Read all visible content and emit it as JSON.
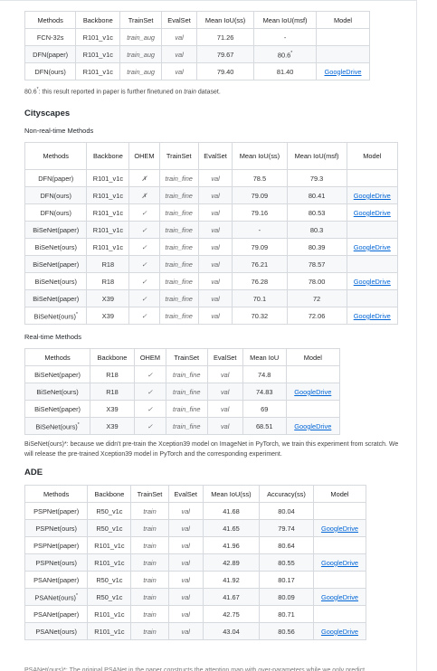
{
  "top_table": {
    "headers": [
      "Methods",
      "Backbone",
      "TrainSet",
      "EvalSet",
      "Mean IoU(ss)",
      "Mean IoU(msf)",
      "Model"
    ],
    "rows": [
      [
        "FCN-32s",
        "R101_v1c",
        "train_aug",
        "val",
        "71.26",
        "-",
        ""
      ],
      [
        "DFN(paper)",
        "R101_v1c",
        "train_aug",
        "val",
        "79.67",
        "80.6",
        ""
      ],
      [
        "DFN(ours)",
        "R101_v1c",
        "train_aug",
        "val",
        "79.40",
        "81.40",
        "GoogleDrive"
      ]
    ]
  },
  "top_note": {
    "prefix": "80.6",
    "middle": ": this result reported in paper is further finetuned on ",
    "italic": "train",
    "suffix": " dataset."
  },
  "cityscapes": {
    "title": "Cityscapes",
    "nonrealtime_title": "Non-real-time Methods",
    "nonrealtime_headers": [
      "Methods",
      "Backbone",
      "OHEM",
      "TrainSet",
      "EvalSet",
      "Mean IoU(ss)",
      "Mean IoU(msf)",
      "Model"
    ],
    "nonrealtime_rows": [
      [
        "DFN(paper)",
        "R101_v1c",
        "✗",
        "train_fine",
        "val",
        "78.5",
        "79.3",
        ""
      ],
      [
        "DFN(ours)",
        "R101_v1c",
        "✗",
        "train_fine",
        "val",
        "79.09",
        "80.41",
        "GoogleDrive"
      ],
      [
        "DFN(ours)",
        "R101_v1c",
        "✓",
        "train_fine",
        "val",
        "79.16",
        "80.53",
        "GoogleDrive"
      ],
      [
        "BiSeNet(paper)",
        "R101_v1c",
        "✓",
        "train_fine",
        "val",
        "-",
        "80.3",
        ""
      ],
      [
        "BiSeNet(ours)",
        "R101_v1c",
        "✓",
        "train_fine",
        "val",
        "79.09",
        "80.39",
        "GoogleDrive"
      ],
      [
        "BiSeNet(paper)",
        "R18",
        "✓",
        "train_fine",
        "val",
        "76.21",
        "78.57",
        ""
      ],
      [
        "BiSeNet(ours)",
        "R18",
        "✓",
        "train_fine",
        "val",
        "76.28",
        "78.00",
        "GoogleDrive"
      ],
      [
        "BiSeNet(paper)",
        "X39",
        "✓",
        "train_fine",
        "val",
        "70.1",
        "72",
        ""
      ],
      [
        "BiSeNet(ours)*",
        "X39",
        "✓",
        "train_fine",
        "val",
        "70.32",
        "72.06",
        "GoogleDrive"
      ]
    ],
    "realtime_title": "Real-time Methods",
    "realtime_headers": [
      "Methods",
      "Backbone",
      "OHEM",
      "TrainSet",
      "EvalSet",
      "Mean IoU",
      "Model"
    ],
    "realtime_rows": [
      [
        "BiSeNet(paper)",
        "R18",
        "✓",
        "train_fine",
        "val",
        "74.8",
        ""
      ],
      [
        "BiSeNet(ours)",
        "R18",
        "✓",
        "train_fine",
        "val",
        "74.83",
        "GoogleDrive"
      ],
      [
        "BiSeNet(paper)",
        "X39",
        "✓",
        "train_fine",
        "val",
        "69",
        ""
      ],
      [
        "BiSeNet(ours)*",
        "X39",
        "✓",
        "train_fine",
        "val",
        "68.51",
        "GoogleDrive"
      ]
    ],
    "note": "BiSeNet(ours)*: because we didn't pre-train the Xception39 model on ImageNet in PyTorch, we train this experiment from scratch. We will release the pre-trained Xception39 model in PyTorch and the corresponding experiment."
  },
  "ade": {
    "title": "ADE",
    "headers": [
      "Methods",
      "Backbone",
      "TrainSet",
      "EvalSet",
      "Mean IoU(ss)",
      "Accuracy(ss)",
      "Model"
    ],
    "rows": [
      [
        "PSPNet(paper)",
        "R50_v1c",
        "train",
        "val",
        "41.68",
        "80.04",
        ""
      ],
      [
        "PSPNet(ours)",
        "R50_v1c",
        "train",
        "val",
        "41.65",
        "79.74",
        "GoogleDrive"
      ],
      [
        "PSPNet(paper)",
        "R101_v1c",
        "train",
        "val",
        "41.96",
        "80.64",
        ""
      ],
      [
        "PSPNet(ours)",
        "R101_v1c",
        "train",
        "val",
        "42.89",
        "80.55",
        "GoogleDrive"
      ],
      [
        "PSANet(paper)",
        "R50_v1c",
        "train",
        "val",
        "41.92",
        "80.17",
        ""
      ],
      [
        "PSANet(ours)*",
        "R50_v1c",
        "train",
        "val",
        "41.67",
        "80.09",
        "GoogleDrive"
      ],
      [
        "PSANet(paper)",
        "R101_v1c",
        "train",
        "val",
        "42.75",
        "80.71",
        ""
      ],
      [
        "PSANet(ours)",
        "R101_v1c",
        "train",
        "val",
        "43.04",
        "80.56",
        "GoogleDrive"
      ]
    ]
  },
  "bottom_cut_text": "PSANet(ours)*: The original PSANet in the paper constructs the attention map with over-parameters while we only predict"
}
